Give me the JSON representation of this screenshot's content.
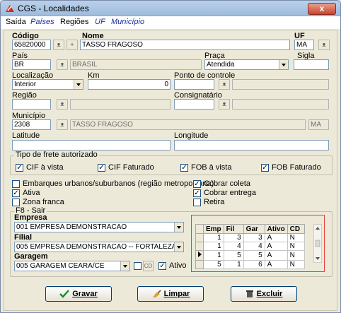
{
  "window": {
    "title": "CGS - Localidades",
    "close_label": "x"
  },
  "menu": [
    "Saída",
    "Países",
    "Regiões",
    "UF",
    "Município"
  ],
  "form": {
    "codigo_label": "Código",
    "codigo_value": "65820000",
    "nome_label": "Nome",
    "nome_value": "TASSO FRAGOSO",
    "uf_label": "UF",
    "uf_value": "MA",
    "pais_label": "País",
    "pais_code": "BR",
    "pais_name": "BRASIL",
    "praca_label": "Praça",
    "praca_value": "Atendida",
    "sigla_label": "Sigla",
    "sigla_value": "",
    "localizacao_label": "Localização",
    "localizacao_value": "Interior",
    "km_label": "Km",
    "km_value": "0",
    "ponto_label": "Ponto de controle",
    "regiao_label": "Região",
    "consignatario_label": "Consignatário",
    "municipio_label": "Município",
    "municipio_code": "2308",
    "municipio_name": "TASSO FRAGOSO",
    "municipio_uf": "MA",
    "latitude_label": "Latitude",
    "longitude_label": "Longitude"
  },
  "frete": {
    "group_label": "Tipo de frete autorizado",
    "options": [
      "CIF à vista",
      "CIF Faturado",
      "FOB à vista",
      "FOB Faturado"
    ]
  },
  "flags": {
    "embarques": "Embarques urbanos/suburbanos (região metropolitana)",
    "ativa": "Ativa",
    "zona_franca": "Zona franca",
    "cobrar_coleta": "Cobrar coleta",
    "cobrar_entrega": "Cobrar entrega",
    "retira": "Retira"
  },
  "f8": {
    "group_label": "F8 - Sair",
    "empresa_label": "Empresa",
    "empresa_value": "001 EMPRESA DEMONSTRACAO",
    "filial_label": "Filial",
    "filial_value": "005 EMPRESA DEMONSTRACAO -- FORTALEZA/C",
    "garagem_label": "Garagem",
    "garagem_value": "005 GARAGEM CEARA/CE",
    "cd_label": "CD",
    "ativo_label": "Ativo"
  },
  "grid": {
    "columns": [
      "Emp",
      "Fil",
      "Gar",
      "Ativo",
      "CD"
    ],
    "rows": [
      [
        "1",
        "3",
        "3",
        "A",
        "N"
      ],
      [
        "1",
        "4",
        "4",
        "A",
        "N"
      ],
      [
        "1",
        "5",
        "5",
        "A",
        "N"
      ],
      [
        "5",
        "1",
        "6",
        "A",
        "N"
      ]
    ]
  },
  "buttons": {
    "gravar": "Gravar",
    "limpar": "Limpar",
    "excluir": "Excluir"
  }
}
